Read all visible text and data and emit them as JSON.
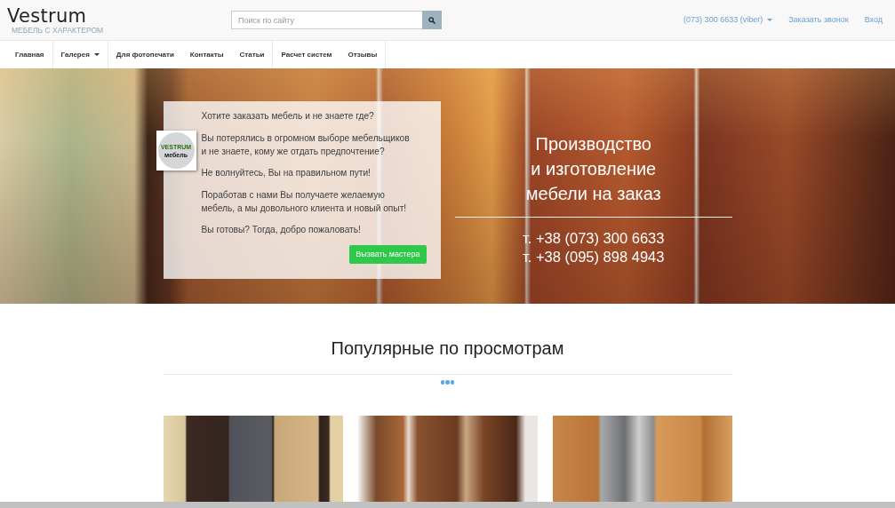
{
  "header": {
    "brand": "Vestrum",
    "tagline": "МЕБЕЛЬ С ХАРАКТЕРОМ",
    "search": {
      "placeholder": "Поиск по сайту"
    },
    "links": [
      {
        "label": "(073) 300 6633 (viber)",
        "kind": "dropdown"
      },
      {
        "label": "Заказать звонок",
        "kind": "link"
      },
      {
        "label": "Вход",
        "kind": "link"
      }
    ]
  },
  "menu": [
    {
      "label": "Главная",
      "kind": "link"
    },
    {
      "label": "Галерея",
      "kind": "dropdown"
    },
    {
      "label": "Для фотопечати",
      "kind": "link"
    },
    {
      "label": "Контакты",
      "kind": "link"
    },
    {
      "label": "Статьи",
      "kind": "link"
    },
    {
      "label": "Расчет систем",
      "kind": "link"
    },
    {
      "label": "Отзывы",
      "kind": "link"
    }
  ],
  "hero": {
    "intro": {
      "logo": {
        "word": "VESTRUM",
        "sub": "мебель"
      },
      "paragraphs": [
        "Хотите заказать мебель и не знаете где?",
        "Вы потерялись в огромном выборе мебельщиков и не знаете, кому же отдать предпочтение?",
        "Не волнуйтесь, Вы на правильном пути!",
        "Поработав с нами Вы получаете желаемую мебель, а мы довольного клиента и новый опыт!",
        "Вы готовы? Тогда, добро пожаловать!"
      ],
      "button": "Вызвать мастера"
    },
    "title": "Производство\nи изготовление\nмебели на заказ",
    "phones": [
      "т. +38 (073) 300 6633",
      "т. +38 (095) 898 4943"
    ]
  },
  "popular": {
    "title": "Популярные по просмотрам"
  }
}
